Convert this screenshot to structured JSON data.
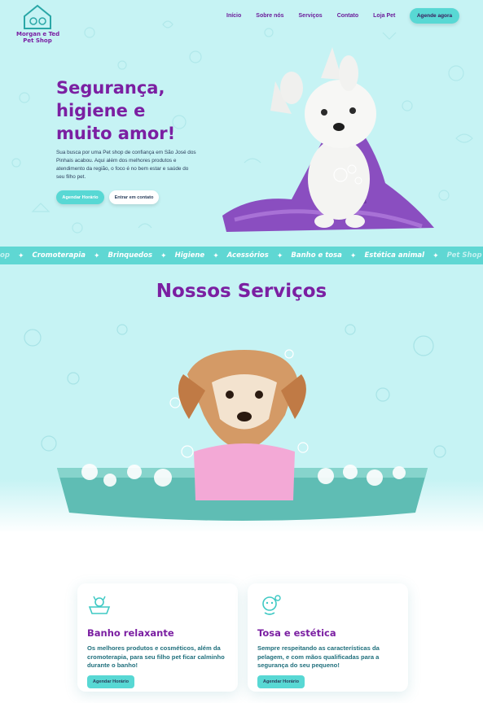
{
  "brand": {
    "logo_line1": "Morgan e Ted",
    "logo_line2": "Pet Shop"
  },
  "nav": {
    "items": [
      {
        "label": "Início"
      },
      {
        "label": "Sobre nós"
      },
      {
        "label": "Serviços"
      },
      {
        "label": "Contato"
      },
      {
        "label": "Loja Pet"
      }
    ],
    "cta_label": "Agende agora"
  },
  "hero": {
    "title_line1": "Segurança,",
    "title_line2": "higiene e",
    "title_line3": "muito amor!",
    "text": "Sua busca por uma Pet shop de confiança em São José dos Pinhais acabou. Aqui além dos melhores produtos e atendimento da região, o foco é no bem estar e saúde do seu filho pet.",
    "primary_button": "Agendar Horário",
    "secondary_button": "Entrar em contato"
  },
  "ticker": {
    "items": [
      "op",
      "Cromoterapia",
      "Brinquedos",
      "Higiene",
      "Acessórios",
      "Banho e tosa",
      "Estética animal",
      "Pet Shop"
    ]
  },
  "services": {
    "title": "Nossos Serviços",
    "cards": [
      {
        "icon": "bathtub-dog-icon",
        "title": "Banho relaxante",
        "text": "Os melhores produtos e cosméticos, além da cromoterapia, para seu filho pet ficar calminho durante o banho!",
        "button": "Agendar Horário"
      },
      {
        "icon": "dog-grooming-icon",
        "title": "Tosa e estética",
        "text": "Sempre respeitando as características da pelagem, e com mãos qualificadas para a segurança do seu pequeno!",
        "button": "Agendar Horário"
      }
    ]
  },
  "colors": {
    "accent": "#58d8d4",
    "brand_purple": "#7b1fa2",
    "background": "#c6f3f4",
    "ticker": "#5fd7d3"
  }
}
